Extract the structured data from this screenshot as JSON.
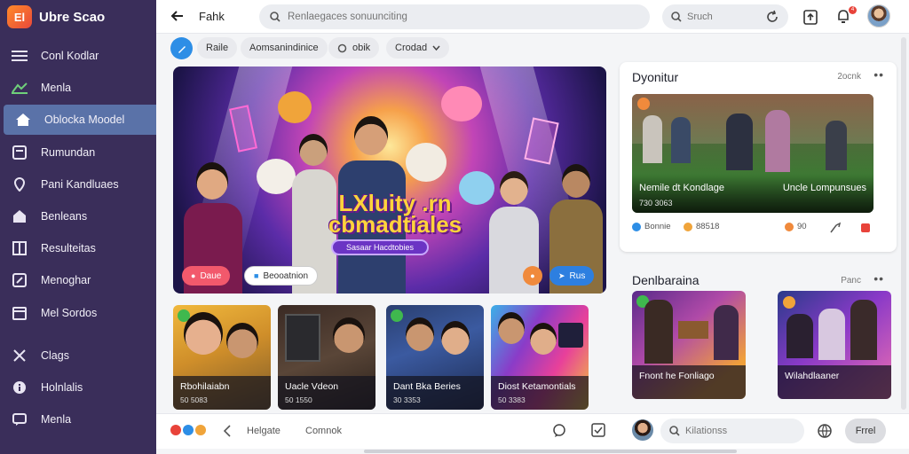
{
  "app": {
    "name": "Ubre Scao",
    "logo_text": "El"
  },
  "sidebar": {
    "items": [
      {
        "label": "Conl Kodlar",
        "icon": "menu-icon"
      },
      {
        "label": "Menla",
        "icon": "chart-icon"
      },
      {
        "label": "Oblocka Moodel",
        "icon": "home-icon"
      },
      {
        "label": "Rumundan",
        "icon": "doc-icon"
      },
      {
        "label": "Pani Kandluaes",
        "icon": "pin-icon"
      },
      {
        "label": "Benleans",
        "icon": "house-icon"
      },
      {
        "label": "Resulteitas",
        "icon": "grid-icon"
      },
      {
        "label": "Menoghar",
        "icon": "edit-icon"
      },
      {
        "label": "Mel Sordos",
        "icon": "calendar-icon"
      },
      {
        "label": "Clags",
        "icon": "tools-icon"
      },
      {
        "label": "Holnlalis",
        "icon": "info-icon"
      },
      {
        "label": "Menla",
        "icon": "chat-icon"
      }
    ],
    "active_index": 2
  },
  "topbar": {
    "title": "Fahk",
    "search_placeholder": "Renlaegaces sonuunciting",
    "search2_placeholder": "Sruch",
    "notification_count": "4"
  },
  "chips": [
    "Raile",
    "Aomsanindinice",
    "obik",
    "Crodad"
  ],
  "hero": {
    "title_line1": "LXluity .rn",
    "title_line2": "cbmadtiales",
    "subtitle": "Sasaar Hacdtobies",
    "left_button": "Daue",
    "mid_button": "Beooatnion",
    "right_button": "Rus"
  },
  "thumbnails": [
    {
      "title": "Rbohilaiabn",
      "meta": "50 5083"
    },
    {
      "title": "Uacle Vdeon",
      "meta": "50 1550"
    },
    {
      "title": "Dant Bka Beries",
      "meta": "30 3353"
    },
    {
      "title": "Diost Ketamontials",
      "meta": "50 3383"
    }
  ],
  "panel1": {
    "title": "Dyonitur",
    "action": "2ocnk",
    "video_title_left": "Nemile dt Kondlage",
    "video_title_right": "Uncle Lompunsues",
    "video_meta": "730 3063",
    "stats": [
      "Bonnie",
      "88518",
      "90"
    ]
  },
  "panel2": {
    "title": "Denlbaraina",
    "action": "Panc",
    "cards": [
      {
        "title": "Fnont he Fonliago"
      },
      {
        "title": "Wilahdlaaner"
      }
    ]
  },
  "bottombar": {
    "left_text": "Helgate",
    "mid_text": "Comnok",
    "reply_placeholder": "Kilationss",
    "send_label": "Frrel"
  }
}
